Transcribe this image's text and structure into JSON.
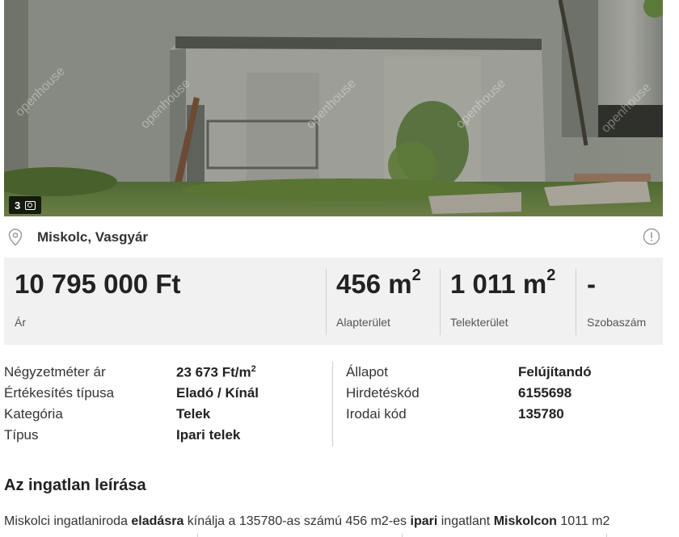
{
  "photo": {
    "count": "3",
    "watermark": "openhouse"
  },
  "location": {
    "text": "Miskolc, Vasgyár"
  },
  "stats": [
    {
      "value": "10 795 000 Ft",
      "unit": "",
      "label": "Ár"
    },
    {
      "value": "456 m",
      "unit": "2",
      "label": "Alapterület"
    },
    {
      "value": "1 011 m",
      "unit": "2",
      "label": "Telekterület"
    },
    {
      "value": "-",
      "unit": "",
      "label": "Szobaszám"
    }
  ],
  "details_left": [
    {
      "key": "Négyzetméter ár",
      "value": "23 673 Ft/m",
      "unit": "2"
    },
    {
      "key": "Értékesítés típusa",
      "value": "Eladó / Kínál"
    },
    {
      "key": "Kategória",
      "value": "Telek"
    },
    {
      "key": "Típus",
      "value": "Ipari telek"
    }
  ],
  "details_right": [
    {
      "key": "Állapot",
      "value": "Felújítandó"
    },
    {
      "key": "Hirdetéskód",
      "value": "6155698"
    },
    {
      "key": "Irodai kód",
      "value": "135780"
    }
  ],
  "description": {
    "title": "Az ingatlan leírása",
    "parts": [
      "Miskolci ingatlaniroda ",
      "eladásra",
      " kínálja a 135780-as számú 456 m2-es ",
      "ipari",
      " ingatlant ",
      "Miskolcon",
      " 1011 m2"
    ]
  }
}
